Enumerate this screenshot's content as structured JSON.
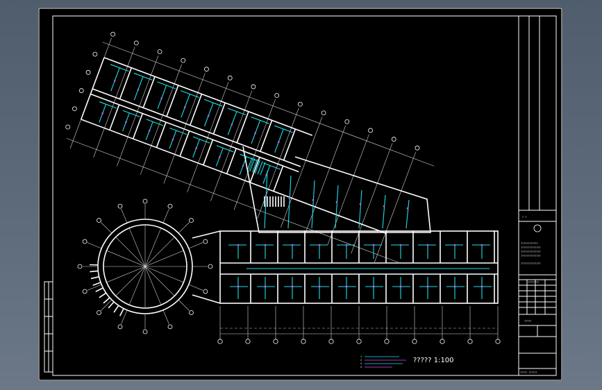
{
  "drawing": {
    "scale_label": "????? 1:100",
    "background": "#000000",
    "wire_color": "#19e3ea",
    "device_color": "#e24be5",
    "line_color": "#ffffff"
  },
  "title_block": {
    "label_top": "?  ?",
    "company_lines": [
      "????????????",
      "??????????????",
      "??????????????",
      "??????????????"
    ],
    "code_line": "??????????????",
    "table_header": "????????",
    "sheet_no": "?????",
    "bottom_line": "?????  ??????"
  },
  "legend": {
    "lines": [
      "1",
      "2",
      "3",
      "4"
    ]
  }
}
